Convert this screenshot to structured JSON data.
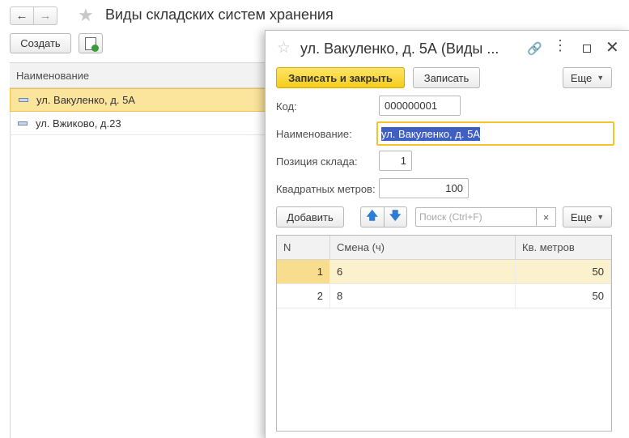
{
  "main": {
    "title": "Виды складских систем хранения",
    "nav": {
      "back_icon": "←",
      "forward_icon": "→"
    },
    "create_label": "Создать",
    "column_name": "Наименование",
    "rows": [
      {
        "name": "ул. Вакуленко, д. 5А",
        "selected": true
      },
      {
        "name": "ул. Вжиково, д.23",
        "selected": false
      }
    ]
  },
  "form": {
    "title": "ул. Вакуленко, д. 5А (Виды ...",
    "toolbar": {
      "save_close_label": "Записать и закрыть",
      "save_label": "Записать",
      "more_label": "Еще"
    },
    "fields": {
      "code_label": "Код:",
      "code_value": "000000001",
      "name_label": "Наименование:",
      "name_value": "ул. Вакуленко, д. 5А",
      "position_label": "Позиция склада:",
      "position_value": "1",
      "sqm_label": "Квадратных метров:",
      "sqm_value": "100"
    },
    "table_toolbar": {
      "add_label": "Добавить",
      "search_placeholder": "Поиск (Ctrl+F)",
      "clear_icon": "×",
      "more_label": "Еще"
    },
    "table": {
      "columns": [
        "N",
        "Смена (ч)",
        "Кв. метров"
      ],
      "rows": [
        {
          "n": "1",
          "shift": "6",
          "sqm": "50",
          "selected": true
        },
        {
          "n": "2",
          "shift": "8",
          "sqm": "50",
          "selected": false
        }
      ]
    }
  },
  "colors": {
    "accent_yellow": "#f5cc1c",
    "selection": "#fbe49b",
    "text_highlight": "#3f5fc2",
    "arrow_blue": "#2f7dd3"
  }
}
